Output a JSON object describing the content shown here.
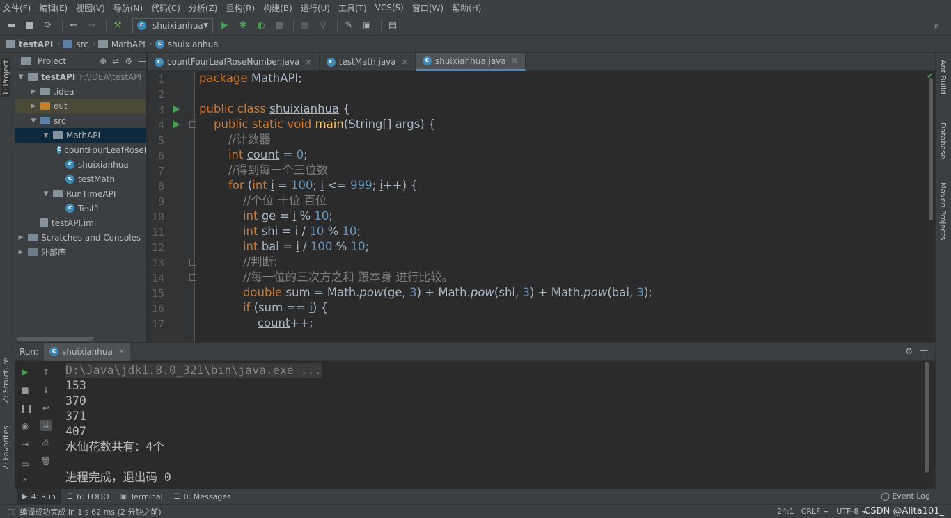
{
  "menu": [
    "文件(F)",
    "编辑(E)",
    "视图(V)",
    "导航(N)",
    "代码(C)",
    "分析(Z)",
    "重构(R)",
    "构建(B)",
    "运行(U)",
    "工具(T)",
    "VCS(S)",
    "窗口(W)",
    "帮助(H)"
  ],
  "toolbar": {
    "run_config": "shuixianhua"
  },
  "breadcrumbs": [
    "testAPI",
    "src",
    "MathAPI",
    "shuixianhua"
  ],
  "left_strip": {
    "project": "1: Project",
    "structure": "Z: Structure",
    "favorites": "2: Favorites"
  },
  "right_strip": {
    "ant": "Ant Build",
    "database": "Database",
    "maven": "Maven Projects"
  },
  "project_panel": {
    "title": "Project",
    "tree": [
      {
        "label": "testAPI",
        "path": "F:\\IDEA\\testAPI",
        "depth": 0,
        "arrow": "▼",
        "icon": "folder",
        "bold": true
      },
      {
        "label": ".idea",
        "depth": 1,
        "arrow": "▶",
        "icon": "folder"
      },
      {
        "label": "out",
        "depth": 1,
        "arrow": "▶",
        "icon": "folder-orange"
      },
      {
        "label": "src",
        "depth": 1,
        "arrow": "▼",
        "icon": "folder-blue"
      },
      {
        "label": "MathAPI",
        "depth": 2,
        "arrow": "▼",
        "icon": "folder",
        "selected": true
      },
      {
        "label": "countFourLeafRoseNumber",
        "depth": 3,
        "arrow": "",
        "icon": "class"
      },
      {
        "label": "shuixianhua",
        "depth": 3,
        "arrow": "",
        "icon": "class"
      },
      {
        "label": "testMath",
        "depth": 3,
        "arrow": "",
        "icon": "class"
      },
      {
        "label": "RunTimeAPI",
        "depth": 2,
        "arrow": "▼",
        "icon": "folder"
      },
      {
        "label": "Test1",
        "depth": 3,
        "arrow": "",
        "icon": "class"
      },
      {
        "label": "testAPI.iml",
        "depth": 1,
        "arrow": "",
        "icon": "file"
      },
      {
        "label": "Scratches and Consoles",
        "depth": 0,
        "arrow": "▶",
        "icon": "scratch"
      },
      {
        "label": "外部库",
        "depth": 0,
        "arrow": "▶",
        "icon": "library"
      }
    ]
  },
  "editor": {
    "tabs": [
      {
        "label": "countFourLeafRoseNumber.java",
        "active": false
      },
      {
        "label": "testMath.java",
        "active": false
      },
      {
        "label": "shuixianhua.java",
        "active": true
      }
    ],
    "line_numbers": [
      "1",
      "2",
      "3",
      "4",
      "5",
      "6",
      "7",
      "8",
      "9",
      "10",
      "11",
      "12",
      "13",
      "14",
      "15",
      "16",
      "17"
    ]
  },
  "run_panel": {
    "label": "Run:",
    "tab": "shuixianhua",
    "output": [
      "D:\\Java\\jdk1.8.0_321\\bin\\java.exe ...",
      "153",
      "370",
      "371",
      "407",
      "水仙花数共有：4个",
      "",
      "进程完成，退出码 0"
    ]
  },
  "bottom_tools": [
    {
      "label": "4: Run",
      "active": true
    },
    {
      "label": "6: TODO",
      "active": false
    },
    {
      "label": "Terminal",
      "active": false
    },
    {
      "label": "0: Messages",
      "active": false
    }
  ],
  "event_log": "Event Log",
  "status": {
    "message": "编译成功完成 in 1 s 62 ms (2 分钟之前)",
    "position": "24:1",
    "line_sep": "CRLF ÷",
    "encoding": "UTF-8 ÷"
  },
  "watermark": "CSDN @Alita101_"
}
